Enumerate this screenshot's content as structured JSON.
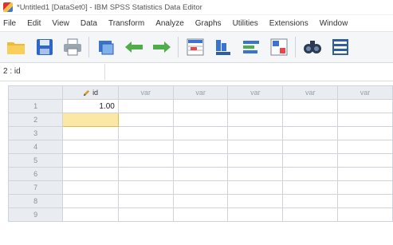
{
  "window": {
    "title": "*Untitled1 [DataSet0] - IBM SPSS Statistics Data Editor"
  },
  "menu": [
    "File",
    "Edit",
    "View",
    "Data",
    "Transform",
    "Analyze",
    "Graphs",
    "Utilities",
    "Extensions",
    "Window"
  ],
  "toolbar": {
    "buttons": [
      "open-folder-icon",
      "save-icon",
      "print-icon",
      "dialog-recall-icon",
      "undo-icon",
      "redo-icon",
      "goto-case-icon",
      "goto-variable-icon",
      "variables-icon",
      "value-labels-icon",
      "find-icon",
      "split-file-icon"
    ]
  },
  "cell_editor": {
    "reference": "2 : id",
    "value": ""
  },
  "grid": {
    "columns": [
      "id",
      "var",
      "var",
      "var",
      "var",
      "var"
    ],
    "rows": [
      {
        "num": "1",
        "values": [
          "1.00",
          "",
          "",
          "",
          "",
          ""
        ]
      },
      {
        "num": "2",
        "values": [
          "",
          "",
          "",
          "",
          "",
          ""
        ]
      },
      {
        "num": "3",
        "values": [
          "",
          "",
          "",
          "",
          "",
          ""
        ]
      },
      {
        "num": "4",
        "values": [
          "",
          "",
          "",
          "",
          "",
          ""
        ]
      },
      {
        "num": "5",
        "values": [
          "",
          "",
          "",
          "",
          "",
          ""
        ]
      },
      {
        "num": "6",
        "values": [
          "",
          "",
          "",
          "",
          "",
          ""
        ]
      },
      {
        "num": "7",
        "values": [
          "",
          "",
          "",
          "",
          "",
          ""
        ]
      },
      {
        "num": "8",
        "values": [
          "",
          "",
          "",
          "",
          "",
          ""
        ]
      },
      {
        "num": "9",
        "values": [
          "",
          "",
          "",
          "",
          "",
          ""
        ]
      }
    ],
    "selected": {
      "row": 2,
      "column": "id"
    }
  }
}
